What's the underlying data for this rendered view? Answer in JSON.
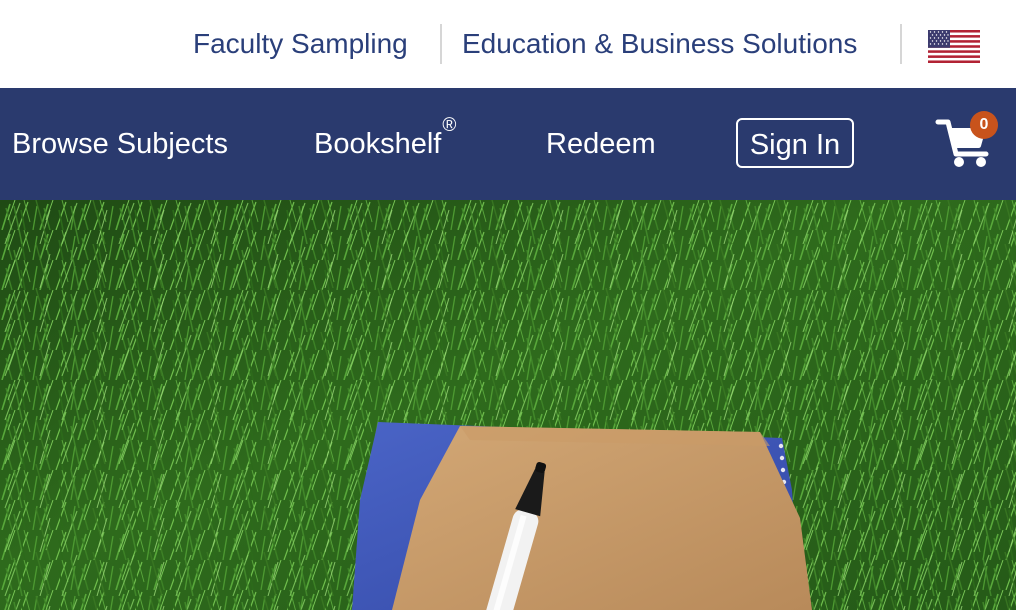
{
  "utility_bar": {
    "links": [
      {
        "label": "Faculty Sampling"
      },
      {
        "label": "Education & Business Solutions"
      }
    ],
    "region_flag_icon": "us-flag-icon"
  },
  "main_nav": {
    "items": [
      {
        "label": "Browse Subjects"
      },
      {
        "label": "Bookshelf",
        "superscript": "®"
      },
      {
        "label": "Redeem"
      }
    ],
    "sign_in_label": "Sign In",
    "cart": {
      "icon": "shopping-cart-icon",
      "count": "0"
    }
  },
  "hero": {
    "description_icon": "notebook-on-grass-photo"
  },
  "colors": {
    "nav_background": "#2a3a6e",
    "utility_link": "#2a3f7a",
    "cart_badge": "#c8531c"
  }
}
